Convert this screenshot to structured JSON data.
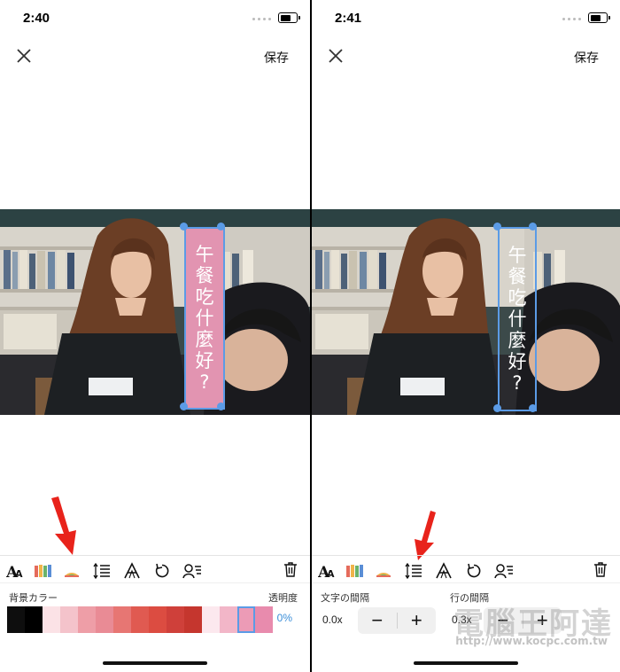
{
  "left": {
    "status_time": "2:40",
    "save_label": "保存",
    "text_chars": [
      "午",
      "餐",
      "吃",
      "什",
      "麼",
      "好",
      "?"
    ],
    "bg_label": "背景カラー",
    "opacity_label": "透明度",
    "opacity_value": "0%",
    "swatch_colors": [
      "#0e0e0e",
      "#000000",
      "#fbe2e6",
      "#f4c3cb",
      "#ee9ea7",
      "#e98b95",
      "#e77673",
      "#e05a51",
      "#dc4c41",
      "#cf403a",
      "#c5362e",
      "#fce8ee",
      "#f2b6c8",
      "#ec9bb6",
      "#e88bad"
    ],
    "selected_swatch": 13,
    "textbox_bg": "#e294b1"
  },
  "right": {
    "status_time": "2:41",
    "save_label": "保存",
    "text_chars": [
      "午",
      "餐",
      "吃",
      "什",
      "麼",
      "好",
      "?"
    ],
    "char_spacing_label": "文字の間隔",
    "line_spacing_label": "行の間隔",
    "char_spacing_value": "0.0x",
    "line_spacing_value": "0.3x",
    "minus": "−",
    "plus": "+"
  },
  "watermark": {
    "big": "電腦王阿達",
    "url": "http://www.kocpc.com.tw"
  },
  "colors": {
    "accent": "#5b9be6",
    "arrow": "#e8231b"
  }
}
